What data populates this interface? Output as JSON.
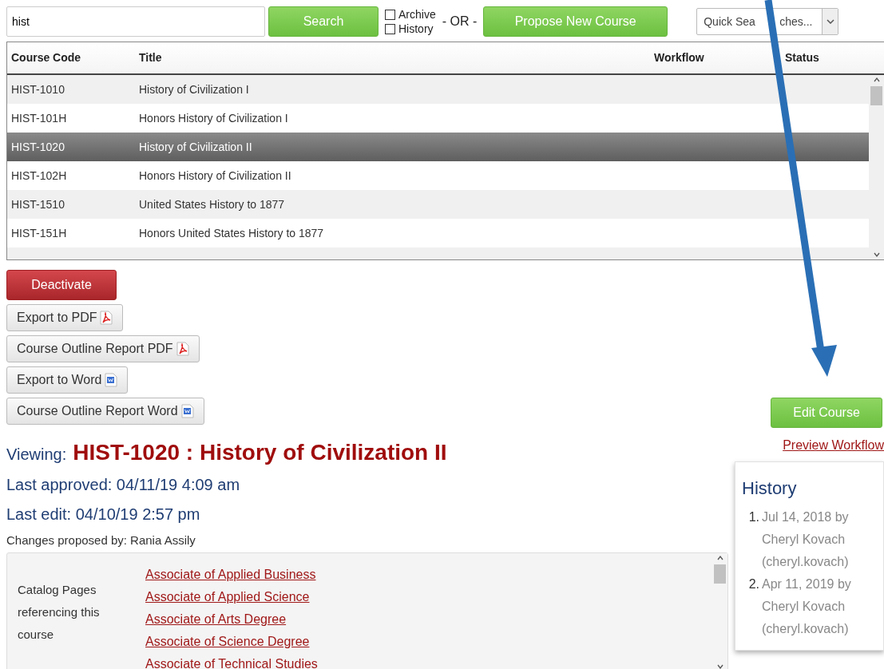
{
  "search": {
    "value": "hist"
  },
  "search_button": "Search",
  "checkboxes": [
    {
      "label": "Archive",
      "checked": false
    },
    {
      "label": "History",
      "checked": false
    }
  ],
  "or_label": "- OR -",
  "propose_button": "Propose New Course",
  "quick_searches": {
    "visible_parts": [
      "Quick Sea",
      "ches..."
    ]
  },
  "table": {
    "columns": [
      "Course Code",
      "Title",
      "Workflow",
      "Status"
    ],
    "rows": [
      {
        "code": "HIST-1010",
        "title": "History of Civilization I",
        "selected": false
      },
      {
        "code": "HIST-101H",
        "title": "Honors History of Civilization I",
        "selected": false
      },
      {
        "code": "HIST-1020",
        "title": "History of Civilization II",
        "selected": true
      },
      {
        "code": "HIST-102H",
        "title": "Honors History of Civilization II",
        "selected": false
      },
      {
        "code": "HIST-1510",
        "title": "United States History to 1877",
        "selected": false
      },
      {
        "code": "HIST-151H",
        "title": "Honors United States History to 1877",
        "selected": false
      }
    ]
  },
  "actions": [
    {
      "label": "Deactivate",
      "kind": "danger"
    },
    {
      "label": "Export to PDF",
      "kind": "pdf"
    },
    {
      "label": "Course Outline Report PDF",
      "kind": "pdf"
    },
    {
      "label": "Export to Word",
      "kind": "word"
    },
    {
      "label": "Course Outline Report Word",
      "kind": "word"
    }
  ],
  "edit_button": "Edit Course",
  "preview_link": "Preview Workflow",
  "viewing": {
    "label": "Viewing:",
    "title": "HIST-1020 : History of Civilization II"
  },
  "last_approved": "Last approved: 04/11/19 4:09 am",
  "last_edit": "Last edit: 04/10/19 2:57 pm",
  "changes_by": "Changes proposed by: Rania Assily",
  "catalog": {
    "label": "Catalog Pages referencing this course",
    "links": [
      "Associate of Applied Business",
      "Associate of Applied Science",
      "Associate of Arts Degree",
      "Associate of Science Degree",
      "Associate of Technical Studies"
    ]
  },
  "history": {
    "title": "History",
    "entries": [
      {
        "number": "1.",
        "date": "Jul 14, 2018 by",
        "name": "Cheryl Kovach",
        "user": "(cheryl.kovach)"
      },
      {
        "number": "2.",
        "date": "Apr 11, 2019 by",
        "name": "Cheryl Kovach",
        "user": "(cheryl.kovach)"
      }
    ]
  }
}
